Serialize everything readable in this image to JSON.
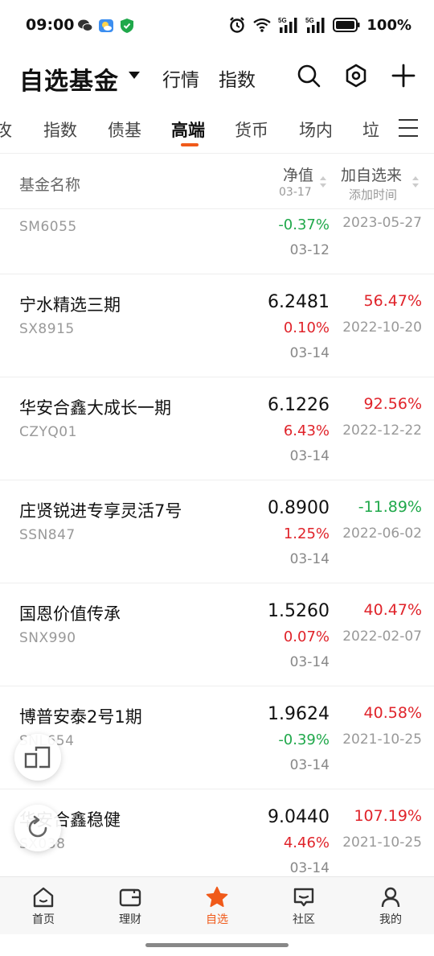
{
  "status_bar": {
    "time": "09:00",
    "battery": "100%",
    "icons": [
      "wechat-icon",
      "weather-icon",
      "shield-icon",
      "alarm-icon",
      "wifi-icon",
      "signal-5g-icon",
      "signal-5g-icon",
      "battery-icon"
    ]
  },
  "header": {
    "title": "自选基金",
    "links": [
      "行情",
      "指数"
    ],
    "icons": [
      "search-icon",
      "settings-icon",
      "add-icon"
    ]
  },
  "tabs": {
    "items": [
      "攻",
      "指数",
      "债基",
      "高端",
      "货币",
      "场内",
      "垃"
    ],
    "active": "高端",
    "menu_icon": "menu-icon"
  },
  "columns": {
    "name": "基金名称",
    "nav": "净值",
    "nav_date": "03-17",
    "added": "加自选来",
    "added_sub": "添加时间"
  },
  "funds": [
    {
      "name": "",
      "code": "SM6055",
      "nav": "",
      "change": "-0.37%",
      "date": "03-12",
      "since": "2023-05-27",
      "added_date": ""
    },
    {
      "name": "宁水精选三期",
      "code": "SX8915",
      "nav": "6.2481",
      "change": "0.10%",
      "date": "03-14",
      "since": "56.47%",
      "added_date": "2022-10-20"
    },
    {
      "name": "华安合鑫大成长一期",
      "code": "CZYQ01",
      "nav": "6.1226",
      "change": "6.43%",
      "date": "03-14",
      "since": "92.56%",
      "added_date": "2022-12-22"
    },
    {
      "name": "庄贤锐进专享灵活7号",
      "code": "SSN847",
      "nav": "0.8900",
      "change": "1.25%",
      "date": "03-14",
      "since": "-11.89%",
      "added_date": "2022-06-02"
    },
    {
      "name": "国恩价值传承",
      "code": "SNX990",
      "nav": "1.5260",
      "change": "0.07%",
      "date": "03-14",
      "since": "40.47%",
      "added_date": "2022-02-07"
    },
    {
      "name": "博普安泰2号1期",
      "code": "SNL654",
      "nav": "1.9624",
      "change": "-0.39%",
      "date": "03-14",
      "since": "40.58%",
      "added_date": "2021-10-25"
    },
    {
      "name": "华安合鑫稳健",
      "code": "SX038",
      "nav": "9.0440",
      "change": "4.46%",
      "date": "03-14",
      "since": "107.19%",
      "added_date": "2021-10-25"
    }
  ],
  "bottom_nav": [
    {
      "label": "首页",
      "icon": "home-icon"
    },
    {
      "label": "理财",
      "icon": "wallet-icon"
    },
    {
      "label": "自选",
      "icon": "star-icon"
    },
    {
      "label": "社区",
      "icon": "chat-icon"
    },
    {
      "label": "我的",
      "icon": "profile-icon"
    }
  ],
  "colors": {
    "accent": "#f05a1a",
    "up": "#e0232a",
    "down": "#1fa84a"
  }
}
